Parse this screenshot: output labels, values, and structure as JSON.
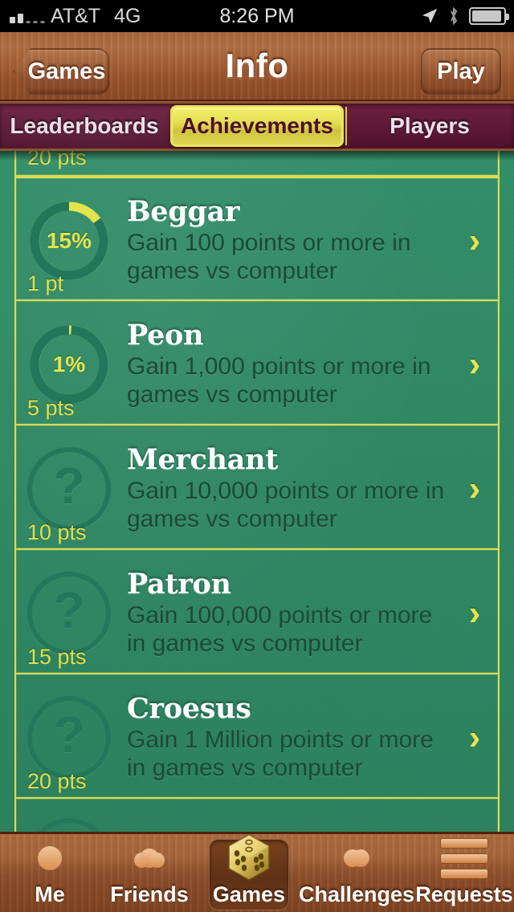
{
  "status_bar": {
    "carrier": "AT&T",
    "network": "4G",
    "time": "8:26 PM",
    "icons": [
      "signal-bars-icon",
      "location-arrow-icon",
      "bluetooth-icon",
      "battery-icon"
    ]
  },
  "nav": {
    "back_label": "Games",
    "title": "Info",
    "action_label": "Play"
  },
  "segments": [
    {
      "label": "Leaderboards",
      "selected": false
    },
    {
      "label": "Achievements",
      "selected": true
    },
    {
      "label": "Players",
      "selected": false
    }
  ],
  "list": {
    "partial_top": {
      "points": "20 pts"
    },
    "rows": [
      {
        "name": "Beggar",
        "description": "Gain 100 points or more in games vs computer",
        "points": "1 pt",
        "progress": "15%",
        "progress_value": 15,
        "locked": false
      },
      {
        "name": "Peon",
        "description": "Gain 1,000 points or more in games vs computer",
        "points": "5 pts",
        "progress": "1%",
        "progress_value": 1,
        "locked": false
      },
      {
        "name": "Merchant",
        "description": "Gain 10,000 points or more in games vs computer",
        "points": "10 pts",
        "progress": "?",
        "progress_value": 0,
        "locked": true
      },
      {
        "name": "Patron",
        "description": "Gain 100,000 points or more in games vs computer",
        "points": "15 pts",
        "progress": "?",
        "progress_value": 0,
        "locked": true
      },
      {
        "name": "Croesus",
        "description": "Gain 1 Million points or more in games vs computer",
        "points": "20 pts",
        "progress": "?",
        "progress_value": 0,
        "locked": true
      }
    ],
    "chevron": "›"
  },
  "tabs": [
    {
      "label": "Me",
      "icon": "person-icon",
      "selected": false
    },
    {
      "label": "Friends",
      "icon": "people-group-icon",
      "selected": false
    },
    {
      "label": "Games",
      "icon": "dice-icon",
      "selected": true
    },
    {
      "label": "Challenges",
      "icon": "two-people-icon",
      "selected": false
    },
    {
      "label": "Requests",
      "icon": "list-lines-icon",
      "selected": false
    }
  ],
  "colors": {
    "felt_green": "#2f8a64",
    "border_yellow": "#dcdc4e",
    "accent_yellow": "#e4e44f",
    "wood_brown": "#a8663c",
    "segment_maroon": "#5d1936",
    "desc_dark_green": "#1b4a35"
  }
}
